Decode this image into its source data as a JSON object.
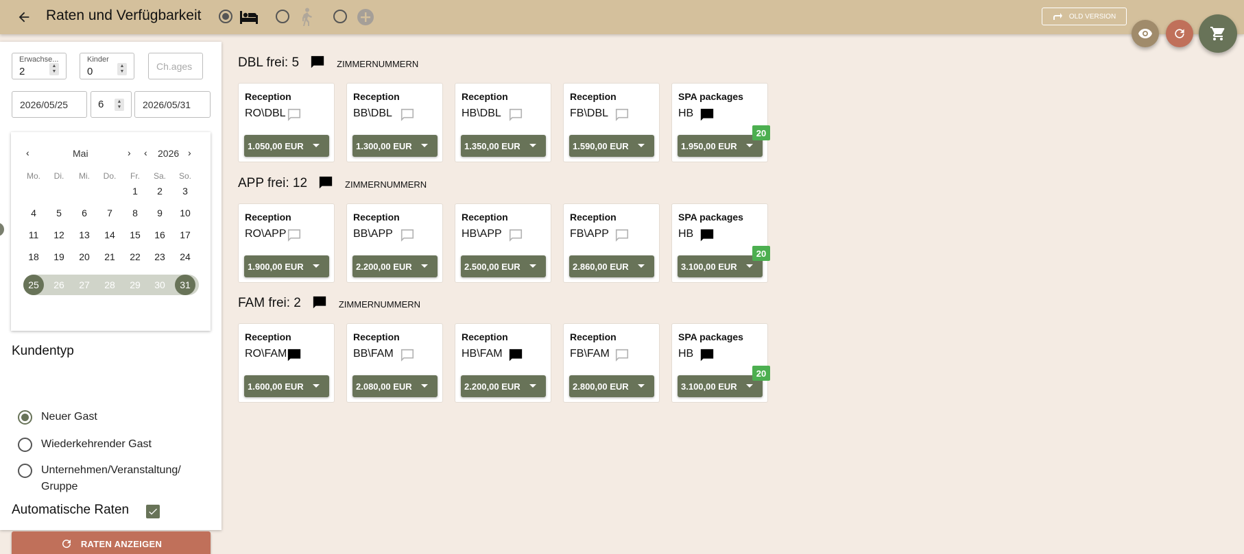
{
  "header": {
    "title": "Raten und Verfügbarkeit",
    "old_version_label": "OLD VERSION",
    "back_icon": "arrow-left-icon",
    "modes": [
      {
        "icon": "bed-icon",
        "checked": true
      },
      {
        "icon": "walk-icon",
        "checked": false
      },
      {
        "icon": "plus-circle-icon",
        "checked": false
      }
    ]
  },
  "fabs": {
    "eye_icon": "eye-icon",
    "refresh_icon": "refresh-icon",
    "cart_icon": "cart-icon"
  },
  "search": {
    "adults_label": "Erwachse...",
    "adults_value": "2",
    "children_label": "Kinder",
    "children_value": "0",
    "child_ages_placeholder": "Ch.ages",
    "date_from": "2026/05/25",
    "nights": "6",
    "date_to": "2026/05/31"
  },
  "calendar": {
    "month": "Mai",
    "year": "2026",
    "weekdays": [
      "Mo.",
      "Di.",
      "Mi.",
      "Do.",
      "Fr.",
      "Sa.",
      "So."
    ],
    "rows": [
      [
        "",
        "",
        "",
        "",
        "1",
        "2",
        "3"
      ],
      [
        "4",
        "5",
        "6",
        "7",
        "8",
        "9",
        "10"
      ],
      [
        "11",
        "12",
        "13",
        "14",
        "15",
        "16",
        "17"
      ],
      [
        "18",
        "19",
        "20",
        "21",
        "22",
        "23",
        "24"
      ],
      [
        "25",
        "26",
        "27",
        "28",
        "29",
        "30",
        "31"
      ]
    ],
    "range_start": "25",
    "range_end": "31"
  },
  "customer_type": {
    "heading": "Kundentyp",
    "options": [
      {
        "label": "Neuer Gast",
        "checked": true
      },
      {
        "label": "Wiederkehrender Gast",
        "checked": false
      },
      {
        "label": "Unternehmen/Veranstaltung/\nGruppe",
        "checked": false
      }
    ]
  },
  "auto_rates": {
    "label": "Automatische Raten",
    "checked": true
  },
  "show_rates_label": "RATEN ANZEIGEN",
  "room_numbers_label": "ZIMMERNUMMERN",
  "colors": {
    "accent": "#687358",
    "header": "#d4c09c",
    "primary_action": "#c0705a",
    "badge": "#4caf50",
    "background": "#f4ebe3"
  },
  "groups": [
    {
      "title": "DBL frei: 5",
      "rates": [
        {
          "source": "Reception",
          "code": "RO\\DBL",
          "price": "1.050,00 EUR",
          "note": false,
          "badge": ""
        },
        {
          "source": "Reception",
          "code": "BB\\DBL",
          "price": "1.300,00 EUR",
          "note": false,
          "badge": ""
        },
        {
          "source": "Reception",
          "code": "HB\\DBL",
          "price": "1.350,00 EUR",
          "note": false,
          "badge": ""
        },
        {
          "source": "Reception",
          "code": "FB\\DBL",
          "price": "1.590,00 EUR",
          "note": false,
          "badge": ""
        },
        {
          "source": "SPA packages",
          "code": "HB",
          "price": "1.950,00 EUR",
          "note": true,
          "badge": "20"
        }
      ]
    },
    {
      "title": "APP frei: 12",
      "rates": [
        {
          "source": "Reception",
          "code": "RO\\APP",
          "price": "1.900,00 EUR",
          "note": false,
          "badge": ""
        },
        {
          "source": "Reception",
          "code": "BB\\APP",
          "price": "2.200,00 EUR",
          "note": false,
          "badge": ""
        },
        {
          "source": "Reception",
          "code": "HB\\APP",
          "price": "2.500,00 EUR",
          "note": false,
          "badge": ""
        },
        {
          "source": "Reception",
          "code": "FB\\APP",
          "price": "2.860,00 EUR",
          "note": false,
          "badge": ""
        },
        {
          "source": "SPA packages",
          "code": "HB",
          "price": "3.100,00 EUR",
          "note": true,
          "badge": "20"
        }
      ]
    },
    {
      "title": "FAM frei: 2",
      "rates": [
        {
          "source": "Reception",
          "code": "RO\\FAM",
          "price": "1.600,00 EUR",
          "note": true,
          "badge": ""
        },
        {
          "source": "Reception",
          "code": "BB\\FAM",
          "price": "2.080,00 EUR",
          "note": false,
          "badge": ""
        },
        {
          "source": "Reception",
          "code": "HB\\FAM",
          "price": "2.200,00 EUR",
          "note": true,
          "badge": ""
        },
        {
          "source": "Reception",
          "code": "FB\\FAM",
          "price": "2.800,00 EUR",
          "note": false,
          "badge": ""
        },
        {
          "source": "SPA packages",
          "code": "HB",
          "price": "3.100,00 EUR",
          "note": true,
          "badge": "20"
        }
      ]
    }
  ]
}
